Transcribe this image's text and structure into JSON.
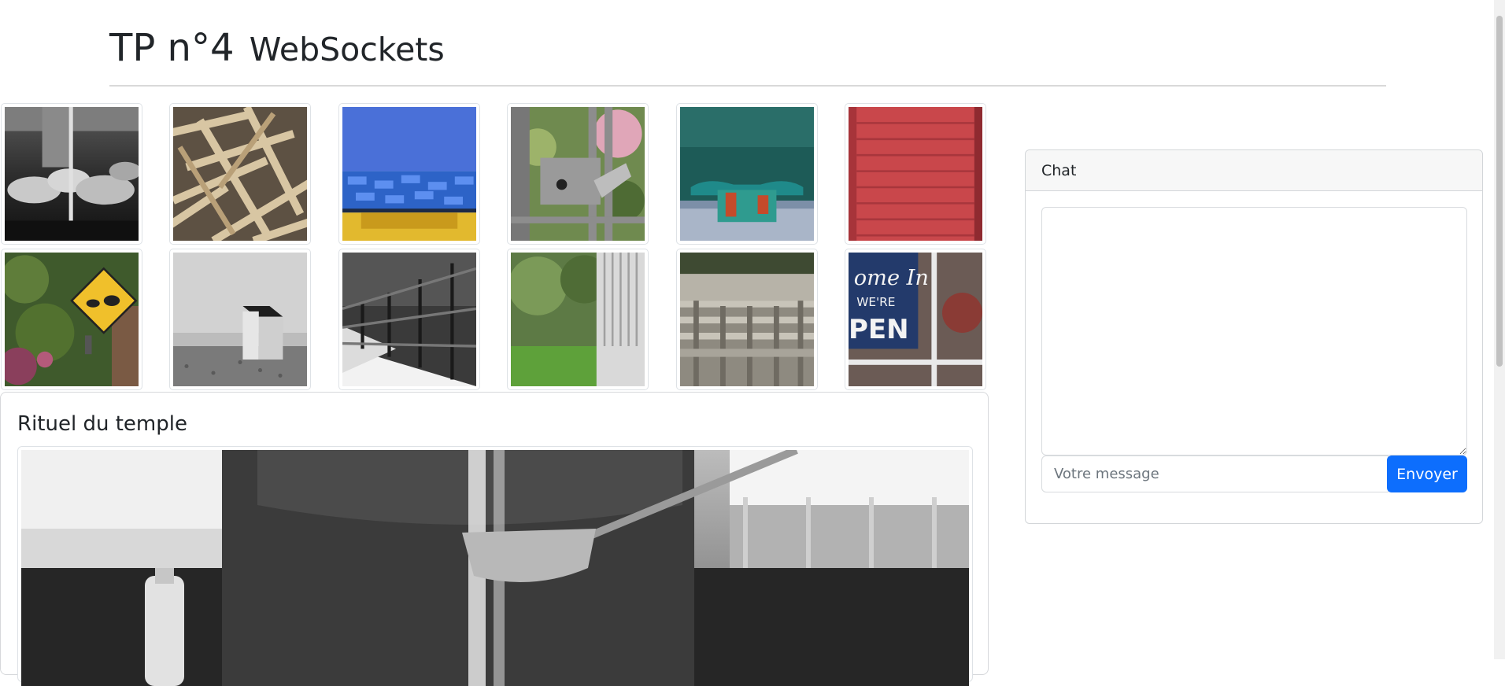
{
  "header": {
    "title_main": "TP n°4",
    "title_sub": "WebSockets"
  },
  "gallery": {
    "items": [
      {
        "icon": "temple-water-ladles-photo"
      },
      {
        "icon": "wooden-slats-photo"
      },
      {
        "icon": "blue-roof-photo"
      },
      {
        "icon": "gate-latch-photo"
      },
      {
        "icon": "mooring-cleat-photo"
      },
      {
        "icon": "red-shutter-photo"
      },
      {
        "icon": "rabbit-sign-photo"
      },
      {
        "icon": "beach-hut-photo"
      },
      {
        "icon": "snowy-fence-photo"
      },
      {
        "icon": "garden-gate-photo"
      },
      {
        "icon": "wooden-bench-photo"
      },
      {
        "icon": "come-in-open-sign-photo"
      }
    ]
  },
  "detail": {
    "title": "Rituel du temple",
    "icon": "temple-water-ladle-large-photo"
  },
  "chat": {
    "header": "Chat",
    "log_value": "",
    "input_value": "",
    "input_placeholder": "Votre message",
    "send_label": "Envoyer"
  },
  "colors": {
    "primary": "#0d6efd",
    "text": "#212529",
    "border": "#dee2e6",
    "card_header": "#f7f7f7"
  }
}
